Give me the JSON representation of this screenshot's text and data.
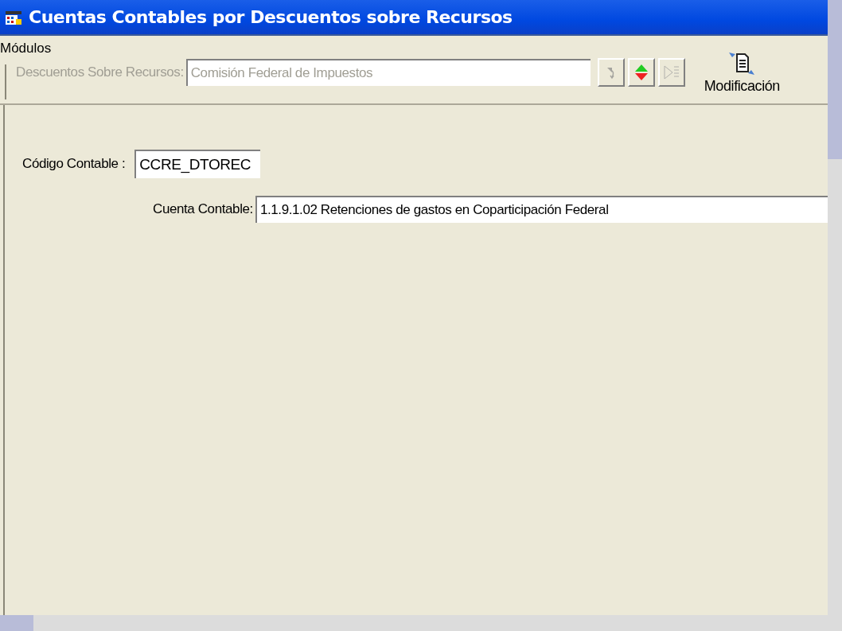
{
  "window": {
    "title": "Cuentas Contables por Descuentos sobre Recursos"
  },
  "toolbar": {
    "group_label": "Módulos",
    "field": {
      "label": "Descuentos Sobre Recursos:",
      "value": "Comisión Federal de Impuestos",
      "disabled": true
    },
    "nav_buttons": [
      {
        "kind": "undo",
        "disabled": true
      },
      {
        "kind": "updown",
        "disabled": false
      },
      {
        "kind": "list",
        "disabled": true
      }
    ],
    "action": {
      "label": "Modificación"
    }
  },
  "form": {
    "fields": [
      {
        "label": "Código Contable :",
        "value": "CCRE_DTOREC"
      },
      {
        "label": "Cuenta Contable:",
        "value": "1.1.9.1.02 Retenciones de gastos en Coparticipación Federal"
      }
    ]
  }
}
